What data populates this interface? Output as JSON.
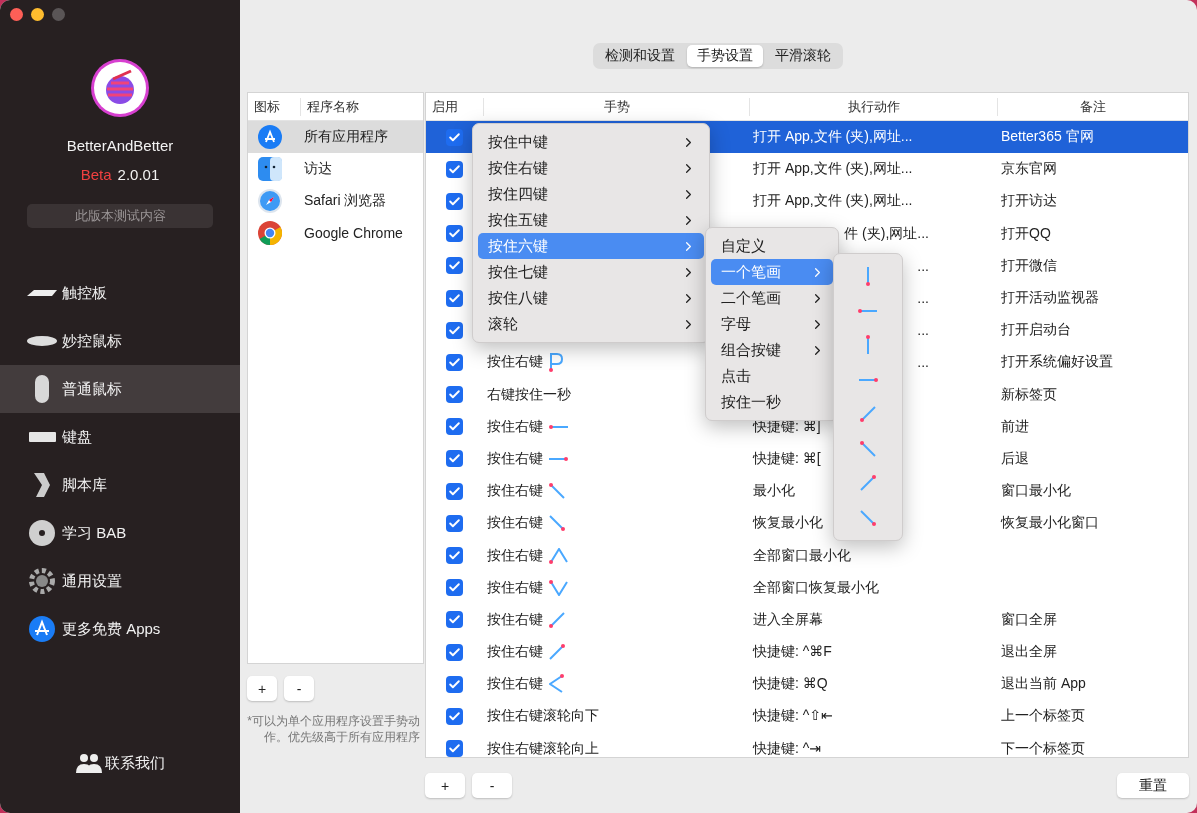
{
  "sidebar": {
    "app_name": "BetterAndBetter",
    "version_label": "Beta",
    "version": "2.0.01",
    "notes_button": "此版本测试内容",
    "items": [
      {
        "label": "触控板",
        "kind": "trackpad",
        "selected": false
      },
      {
        "label": "妙控鼠标",
        "kind": "magicmouse",
        "selected": false
      },
      {
        "label": "普通鼠标",
        "kind": "mouse",
        "selected": true
      },
      {
        "label": "键盘",
        "kind": "keyboard",
        "selected": false
      },
      {
        "label": "脚本库",
        "kind": "script",
        "selected": false
      },
      {
        "label": "学习 BAB",
        "kind": "disc",
        "selected": false
      },
      {
        "label": "通用设置",
        "kind": "gear",
        "selected": false
      },
      {
        "label": "更多免费 Apps",
        "kind": "appstore",
        "selected": false
      }
    ],
    "contact": "联系我们"
  },
  "tabs": [
    {
      "label": "检测和设置",
      "selected": false
    },
    {
      "label": "手势设置",
      "selected": true
    },
    {
      "label": "平滑滚轮",
      "selected": false
    }
  ],
  "apps": {
    "columns": [
      "图标",
      "程序名称"
    ],
    "rows": [
      {
        "name": "所有应用程序",
        "kind": "appstore",
        "selected": true
      },
      {
        "name": "访达",
        "kind": "finder",
        "selected": false
      },
      {
        "name": "Safari 浏览器",
        "kind": "safari",
        "selected": false
      },
      {
        "name": "Google Chrome",
        "kind": "chrome",
        "selected": false
      }
    ],
    "add": "+",
    "remove": "-",
    "note": "*可以为单个应用程序设置手势动作。优先级高于所有应用程序"
  },
  "gestures": {
    "columns": [
      "启用",
      "手势",
      "执行动作",
      "备注"
    ],
    "rows": [
      {
        "enabled": true,
        "selected": true,
        "action": "打开 App,文件 (夹),网址...",
        "note": "Better365 官网"
      },
      {
        "enabled": true,
        "selected": false,
        "action": "打开 App,文件 (夹),网址...",
        "note": "京东官网"
      },
      {
        "enabled": true,
        "selected": false,
        "action": "打开 App,文件 (夹),网址...",
        "note": "打开访达"
      },
      {
        "enabled": true,
        "selected": false,
        "action": "件 (夹),网址...",
        "action_clipped": true,
        "note": "打开QQ"
      },
      {
        "enabled": true,
        "selected": false,
        "action": "...",
        "action_clipped": true,
        "note": "打开微信"
      },
      {
        "enabled": true,
        "selected": false,
        "action": "...",
        "action_clipped": true,
        "note": "打开活动监视器"
      },
      {
        "enabled": true,
        "selected": false,
        "action": "...",
        "action_clipped": true,
        "note": "打开启动台"
      },
      {
        "enabled": true,
        "selected": false,
        "gesture": "按住右键",
        "kind": "p",
        "action": "...",
        "action_clipped": true,
        "note": "打开系统偏好设置"
      },
      {
        "enabled": true,
        "selected": false,
        "gesture": "右键按住一秒",
        "note": "新标签页"
      },
      {
        "enabled": true,
        "selected": false,
        "gesture": "按住右键",
        "kind": "left",
        "action": "快捷键: ⌘]",
        "note": "前进"
      },
      {
        "enabled": true,
        "selected": false,
        "gesture": "按住右键",
        "kind": "right",
        "action": "快捷键: ⌘[",
        "note": "后退"
      },
      {
        "enabled": true,
        "selected": false,
        "gesture": "按住右键",
        "kind": "upleft",
        "action": "最小化",
        "note": "窗口最小化"
      },
      {
        "enabled": true,
        "selected": false,
        "gesture": "按住右键",
        "kind": "downright",
        "action": "恢复最小化",
        "note": "恢复最小化窗口"
      },
      {
        "enabled": true,
        "selected": false,
        "gesture": "按住右键",
        "kind": "caretup",
        "action": "全部窗口最小化"
      },
      {
        "enabled": true,
        "selected": false,
        "gesture": "按住右键",
        "kind": "caretdown",
        "action": "全部窗口恢复最小化"
      },
      {
        "enabled": true,
        "selected": false,
        "gesture": "按住右键",
        "kind": "downleft",
        "action": "进入全屏幕",
        "note": "窗口全屏"
      },
      {
        "enabled": true,
        "selected": false,
        "gesture": "按住右键",
        "kind": "upright",
        "action": "快捷键: ^⌘F",
        "note": "退出全屏"
      },
      {
        "enabled": true,
        "selected": false,
        "gesture": "按住右键",
        "kind": "caretleft",
        "action": "快捷键: ⌘Q",
        "note": "退出当前 App"
      },
      {
        "enabled": true,
        "selected": false,
        "gesture": "按住右键滚轮向下",
        "action": "快捷键: ^⇧⇤",
        "note": "上一个标签页"
      },
      {
        "enabled": true,
        "selected": false,
        "gesture": "按住右键滚轮向上",
        "action": "快捷键: ^⇥",
        "note": "下一个标签页"
      }
    ],
    "add": "+",
    "remove": "-",
    "reset": "重置"
  },
  "menu": {
    "items": [
      {
        "label": "按住中键",
        "selected": false,
        "has_submenu": true
      },
      {
        "label": "按住右键",
        "selected": false,
        "has_submenu": true
      },
      {
        "label": "按住四键",
        "selected": false,
        "has_submenu": true
      },
      {
        "label": "按住五键",
        "selected": false,
        "has_submenu": true
      },
      {
        "label": "按住六键",
        "selected": true,
        "has_submenu": true
      },
      {
        "label": "按住七键",
        "selected": false,
        "has_submenu": true
      },
      {
        "label": "按住八键",
        "selected": false,
        "has_submenu": true
      },
      {
        "label": "滚轮",
        "selected": false,
        "has_submenu": true
      }
    ]
  },
  "submenu": {
    "items": [
      {
        "label": "自定义",
        "selected": false,
        "has_submenu": false
      },
      {
        "label": "一个笔画",
        "selected": true,
        "has_submenu": true
      },
      {
        "label": "二个笔画",
        "selected": false,
        "has_submenu": true
      },
      {
        "label": "字母",
        "selected": false,
        "has_submenu": true
      },
      {
        "label": "组合按键",
        "selected": false,
        "has_submenu": true
      },
      {
        "label": "点击",
        "selected": false,
        "has_submenu": false
      },
      {
        "label": "按住一秒",
        "selected": false,
        "has_submenu": false
      }
    ]
  },
  "stroke_menu": {
    "items": [
      {
        "kind": "down"
      },
      {
        "kind": "left"
      },
      {
        "kind": "up"
      },
      {
        "kind": "right"
      },
      {
        "kind": "downleft"
      },
      {
        "kind": "upleft"
      },
      {
        "kind": "upright"
      },
      {
        "kind": "downright"
      }
    ]
  }
}
